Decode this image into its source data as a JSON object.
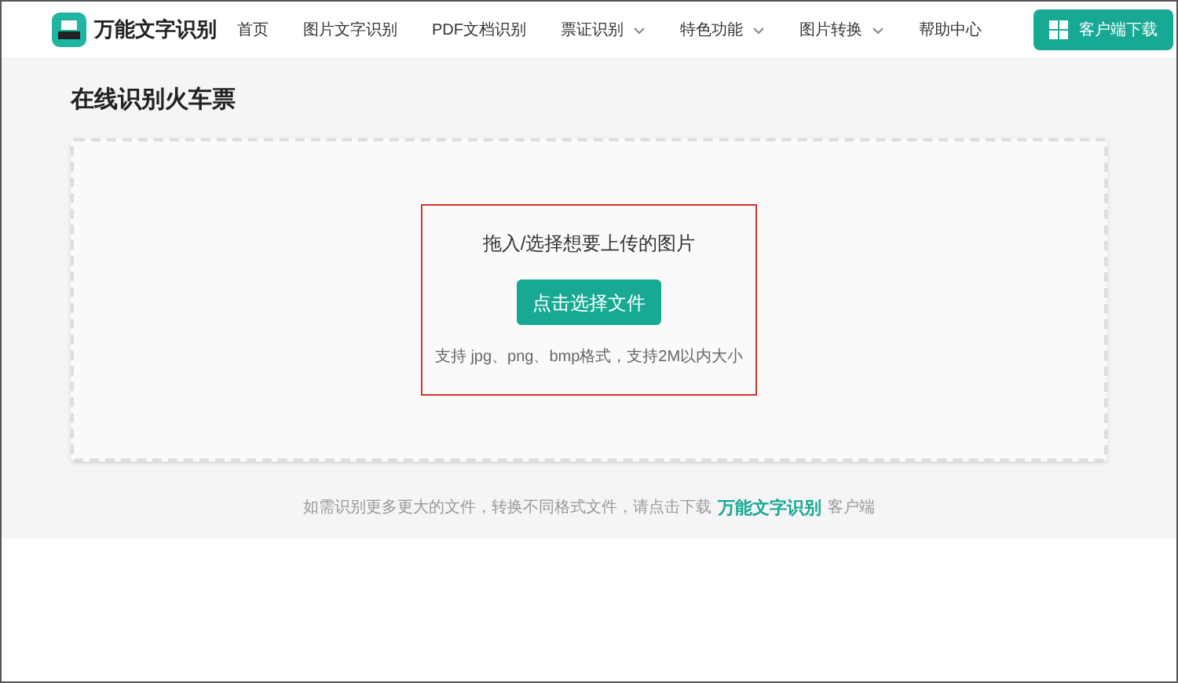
{
  "header": {
    "brand": "万能文字识别",
    "nav": [
      {
        "label": "首页",
        "dropdown": false
      },
      {
        "label": "图片文字识别",
        "dropdown": false
      },
      {
        "label": "PDF文档识别",
        "dropdown": false
      },
      {
        "label": "票证识别",
        "dropdown": true
      },
      {
        "label": "特色功能",
        "dropdown": true
      },
      {
        "label": "图片转换",
        "dropdown": true
      },
      {
        "label": "帮助中心",
        "dropdown": false
      }
    ],
    "download_button": "客户端下载"
  },
  "page_title": "在线识别火车票",
  "upload": {
    "highlighted": true,
    "prompt": "拖入/选择想要上传的图片",
    "button": "点击选择文件",
    "hint": "支持 jpg、png、bmp格式，支持2M以内大小"
  },
  "footer_note": {
    "before": "如需识别更多更大的文件，转换不同格式文件，请点击下载",
    "link": "万能文字识别",
    "after": "客户端"
  }
}
